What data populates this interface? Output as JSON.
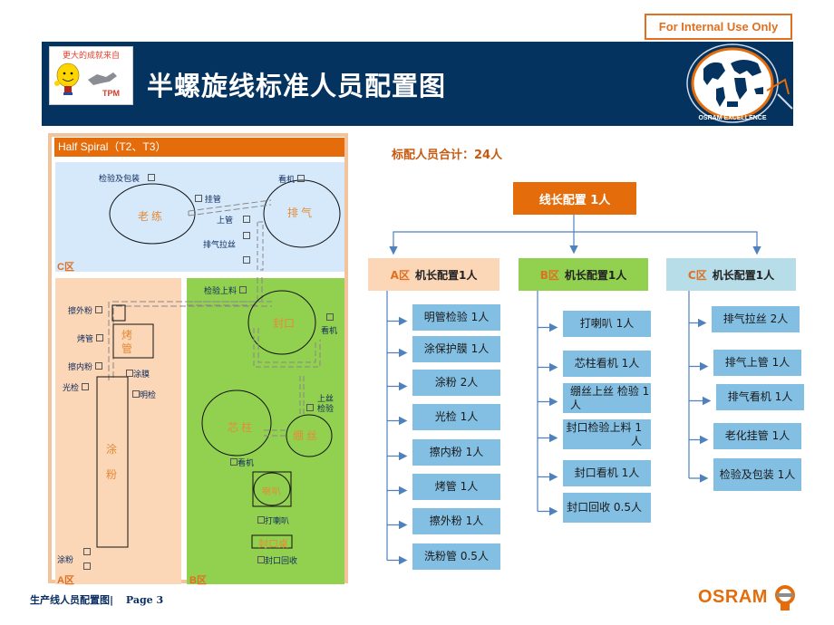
{
  "badge": {
    "text": "For Internal Use Only"
  },
  "header": {
    "title": "半螺旋线标准人员配置图",
    "tpm_logo": {
      "slogan": "更大的成就来自",
      "label": "TPM"
    },
    "excellence_logo": {
      "text": "OSRAM EXCELLENCE"
    }
  },
  "layout": {
    "title": "Half Spiral（T2、T3）",
    "zones": {
      "C": {
        "label": "C区",
        "machines": [
          "老练",
          "排气"
        ],
        "stations": [
          "检验及包装",
          "挂管",
          "看机",
          "上管",
          "排气拉丝"
        ]
      },
      "A": {
        "label": "A区",
        "machines": [
          "烤管",
          "涂粉"
        ],
        "stations": [
          "擦外粉",
          "烤管",
          "擦内粉",
          "光检",
          "涂膜",
          "明检",
          "涂粉"
        ]
      },
      "B": {
        "label": "B区",
        "machines": [
          "封口",
          "芯柱",
          "绷丝",
          "喇叭",
          "封口桌"
        ],
        "stations": [
          "检验上料",
          "看机",
          "上丝检验",
          "看机",
          "打喇叭",
          "封口回收"
        ]
      }
    }
  },
  "org": {
    "total": "标配人员合计：24人",
    "root": "线长配置 1人",
    "branches": [
      {
        "zone": "A区",
        "title": "机长配置1人",
        "color": "#fbd6b7",
        "items": [
          "明管检验 1人",
          "涂保护膜  1人",
          "涂粉  2人",
          "光检  1人",
          "擦内粉  1人",
          "烤管  1人",
          "擦外粉  1人",
          "洗粉管  0.5人"
        ]
      },
      {
        "zone": "B区",
        "title": "机长配置1人",
        "color": "#92d050",
        "items": [
          "打喇叭   1人",
          "芯柱看机 1人",
          "绷丝上丝 检验 1人",
          "封口检验上料 1人",
          "封口看机 1人",
          "封口回收 0.5人"
        ]
      },
      {
        "zone": "C区",
        "title": "机长配置1人",
        "color": "#b7dde8",
        "items": [
          "排气拉丝  2人",
          "排气上管 1人",
          "排气看机 1人",
          "老化挂管 1人",
          "检验及包装 1人"
        ]
      }
    ]
  },
  "footer": {
    "title": "生产线人员配置图",
    "page": "Page  3",
    "brand": "OSRAM"
  },
  "colors": {
    "navy": "#05335f",
    "orange": "#e46c0a",
    "leaf": "#83bfe3",
    "arrow": "#4f81bd"
  }
}
